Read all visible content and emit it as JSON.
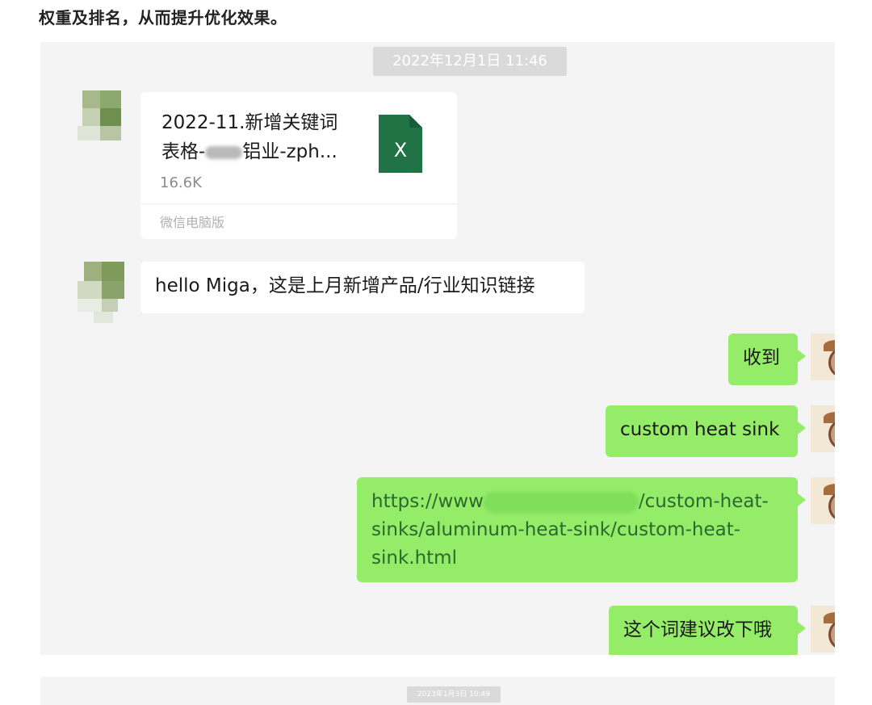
{
  "header": {
    "text": "权重及排名，从而提升优化效果。"
  },
  "chat": {
    "timestamp": "2022年12月1日 11:46",
    "file": {
      "name_line1": "2022-11.新增关键词",
      "name_prefix": "表格-",
      "name_suffix": "铝业-zph...",
      "size": "16.6K",
      "source": "微信电脑版",
      "icon_letter": "X",
      "icon_color": "#217346"
    },
    "messages": {
      "msg1": "hello Miga，这是上月新增产品/行业知识链接",
      "msg2": "收到",
      "msg3": "custom heat sink",
      "msg4_start": "https://www",
      "msg4_rest": "/custom-heat-sinks/aluminum-heat-sink/custom-heat-sink.html",
      "msg5": "这个词建议改下哦"
    },
    "colors": {
      "outgoing_bubble": "#95ec69",
      "incoming_bubble": "#ffffff",
      "background": "#f4f4f4"
    }
  },
  "chat2": {
    "timestamp": "2023年1月3日 10:49"
  }
}
